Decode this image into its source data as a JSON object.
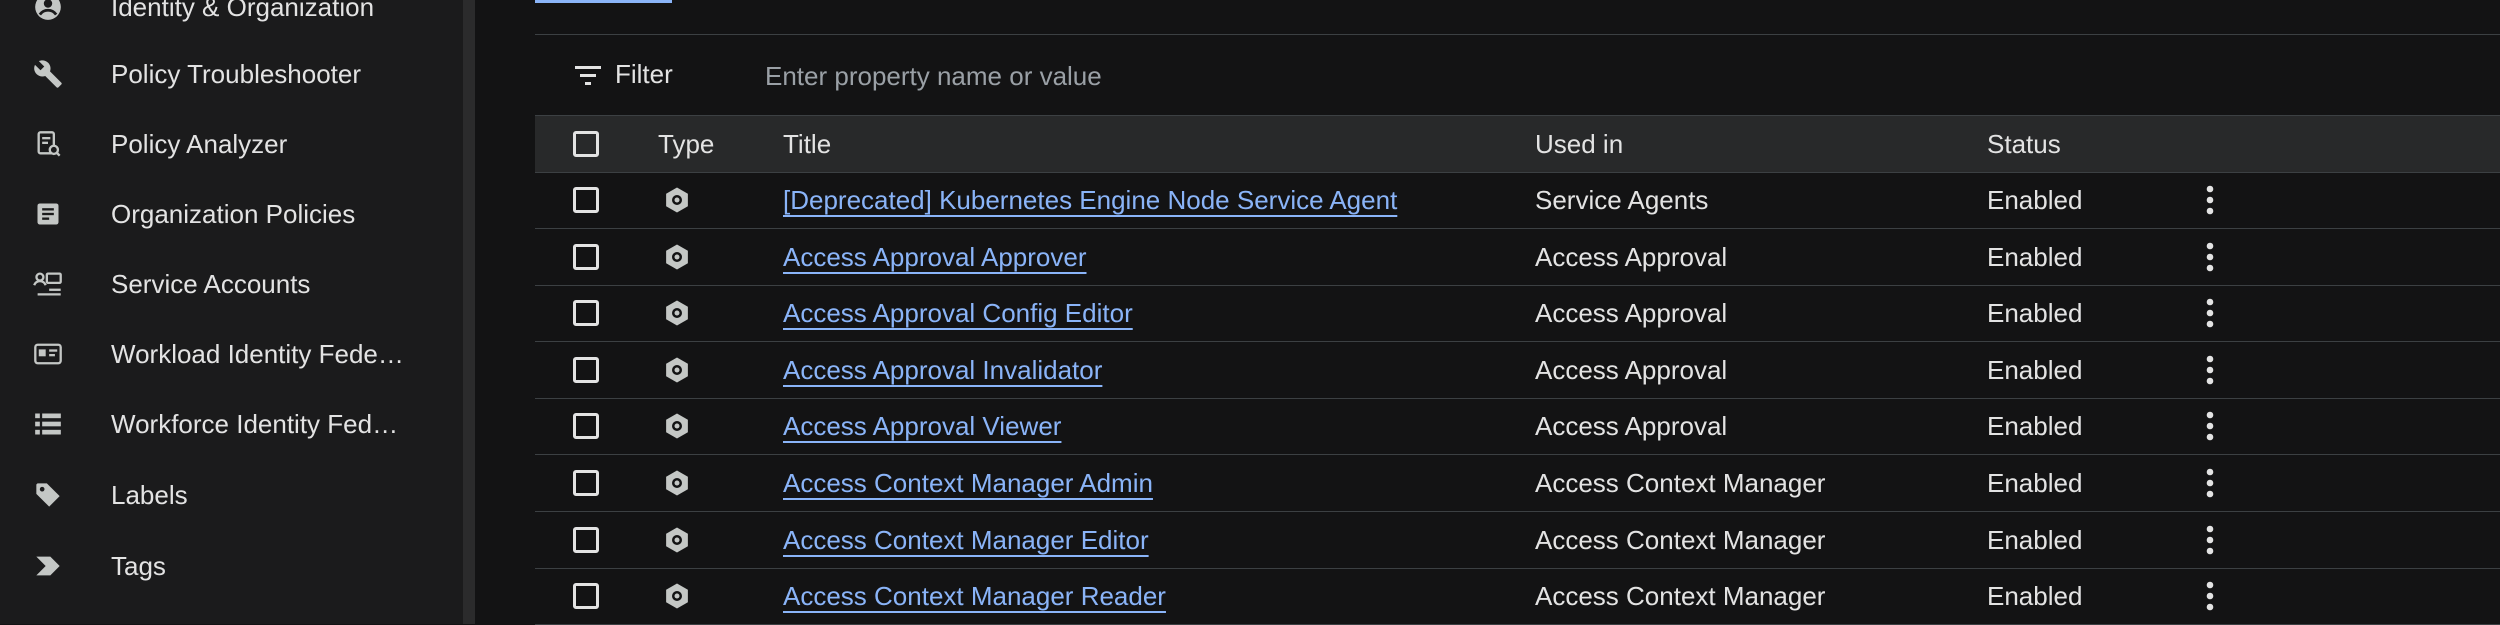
{
  "sidebar": {
    "items": [
      {
        "label": "Identity & Organization",
        "icon": "account-circle-icon"
      },
      {
        "label": "Policy Troubleshooter",
        "icon": "wrench-icon"
      },
      {
        "label": "Policy Analyzer",
        "icon": "document-search-icon"
      },
      {
        "label": "Organization Policies",
        "icon": "article-icon"
      },
      {
        "label": "Service Accounts",
        "icon": "service-account-icon"
      },
      {
        "label": "Workload Identity Fede…",
        "icon": "id-card-icon"
      },
      {
        "label": "Workforce Identity Fed…",
        "icon": "list-icon"
      },
      {
        "label": "Labels",
        "icon": "label-tag-icon"
      },
      {
        "label": "Tags",
        "icon": "tag-chevron-icon"
      }
    ]
  },
  "filter": {
    "label": "Filter",
    "placeholder": "Enter property name or value"
  },
  "table": {
    "headers": {
      "type": "Type",
      "title": "Title",
      "used_in": "Used in",
      "status": "Status"
    },
    "rows": [
      {
        "title": "[Deprecated] Kubernetes Engine Node Service Agent",
        "used_in": "Service Agents",
        "status": "Enabled"
      },
      {
        "title": "Access Approval Approver",
        "used_in": "Access Approval",
        "status": "Enabled"
      },
      {
        "title": "Access Approval Config Editor",
        "used_in": "Access Approval",
        "status": "Enabled"
      },
      {
        "title": "Access Approval Invalidator",
        "used_in": "Access Approval",
        "status": "Enabled"
      },
      {
        "title": "Access Approval Viewer",
        "used_in": "Access Approval",
        "status": "Enabled"
      },
      {
        "title": "Access Context Manager Admin",
        "used_in": "Access Context Manager",
        "status": "Enabled"
      },
      {
        "title": "Access Context Manager Editor",
        "used_in": "Access Context Manager",
        "status": "Enabled"
      },
      {
        "title": "Access Context Manager Reader",
        "used_in": "Access Context Manager",
        "status": "Enabled"
      }
    ]
  },
  "colors": {
    "link": "#8ab4f8",
    "background": "#131314",
    "sidebar": "#1b1b1c",
    "header": "#28292a"
  }
}
